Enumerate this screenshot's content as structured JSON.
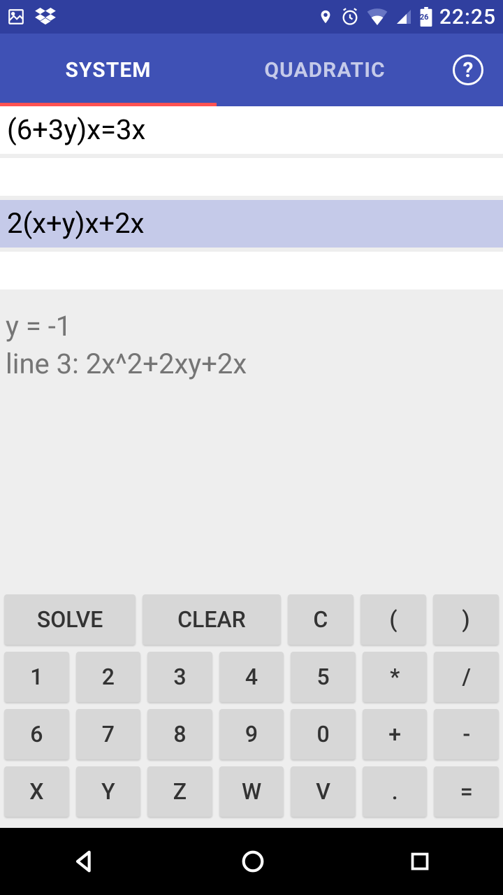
{
  "status": {
    "time": "22:25",
    "battery_level": "26"
  },
  "tabs": {
    "system": "SYSTEM",
    "quadratic": "QUADRATIC",
    "help": "?"
  },
  "equations": {
    "row1": "(6+3y)x=3x",
    "row2": "",
    "row3": "2(x+y)x+2x",
    "row4": ""
  },
  "results": {
    "line1": "y = -1",
    "line2": "line 3: 2x^2+2xy+2x"
  },
  "keys": {
    "solve": "SOLVE",
    "clear": "CLEAR",
    "c": "C",
    "lparen": "(",
    "rparen": ")",
    "k1": "1",
    "k2": "2",
    "k3": "3",
    "k4": "4",
    "k5": "5",
    "star": "*",
    "slash": "/",
    "k6": "6",
    "k7": "7",
    "k8": "8",
    "k9": "9",
    "k0": "0",
    "plus": "+",
    "minus": "-",
    "kx": "X",
    "ky": "Y",
    "kz": "Z",
    "kw": "W",
    "kv": "V",
    "dot": ".",
    "eq": "="
  }
}
